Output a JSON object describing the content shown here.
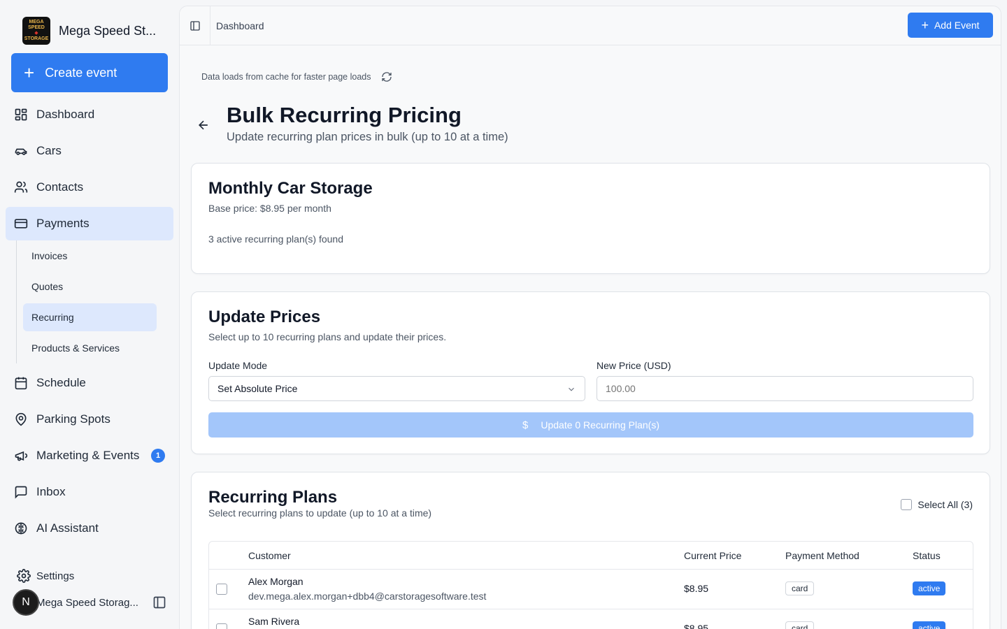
{
  "brand": {
    "name": "Mega Speed St...",
    "logo_line1": "MEGA SPEED",
    "logo_line2": "STORAGE"
  },
  "sidebar": {
    "create_label": "Create event",
    "items": [
      {
        "label": "Dashboard",
        "icon": "dashboard-icon"
      },
      {
        "label": "Cars",
        "icon": "car-icon"
      },
      {
        "label": "Contacts",
        "icon": "users-icon"
      },
      {
        "label": "Payments",
        "icon": "credit-card-icon",
        "active": true
      },
      {
        "label": "Schedule",
        "icon": "calendar-icon"
      },
      {
        "label": "Parking Spots",
        "icon": "map-pin-icon"
      },
      {
        "label": "Marketing & Events",
        "icon": "megaphone-icon",
        "badge": "1"
      },
      {
        "label": "Inbox",
        "icon": "message-icon"
      },
      {
        "label": "AI Assistant",
        "icon": "brain-icon"
      }
    ],
    "payments_sub": [
      {
        "label": "Invoices"
      },
      {
        "label": "Quotes"
      },
      {
        "label": "Recurring",
        "active": true
      },
      {
        "label": "Products & Services"
      }
    ],
    "settings_label": "Settings",
    "account": {
      "initial": "N",
      "name": "Mega Speed Storag..."
    }
  },
  "topbar": {
    "breadcrumb": "Dashboard",
    "add_event_label": "Add Event"
  },
  "page": {
    "cache_note": "Data loads from cache for faster page loads",
    "title": "Bulk Recurring Pricing",
    "subtitle": "Update recurring plan prices in bulk (up to 10 at a time)"
  },
  "product_card": {
    "title": "Monthly Car Storage",
    "base_price": "Base price: $8.95 per month",
    "found": "3 active recurring plan(s) found"
  },
  "update_card": {
    "title": "Update Prices",
    "description": "Select up to 10 recurring plans and update their prices.",
    "mode_label": "Update Mode",
    "mode_value": "Set Absolute Price",
    "price_label": "New Price (USD)",
    "price_placeholder": "100.00",
    "button_label": "Update 0 Recurring Plan(s)"
  },
  "plans_card": {
    "title": "Recurring Plans",
    "description": "Select recurring plans to update (up to 10 at a time)",
    "select_all": "Select All (3)",
    "columns": [
      "Customer",
      "Current Price",
      "Payment Method",
      "Status"
    ],
    "rows": [
      {
        "name": "Alex Morgan",
        "email": "dev.mega.alex.morgan+dbb4@carstoragesoftware.test",
        "price": "$8.95",
        "method": "card",
        "status": "active"
      },
      {
        "name": "Sam Rivera",
        "email": "",
        "price": "$8.95",
        "method": "card",
        "status": "active"
      }
    ]
  },
  "colors": {
    "accent": "#2f7bf0",
    "active_bg": "#dde8fd",
    "disabled_btn": "#a3c6fa"
  }
}
